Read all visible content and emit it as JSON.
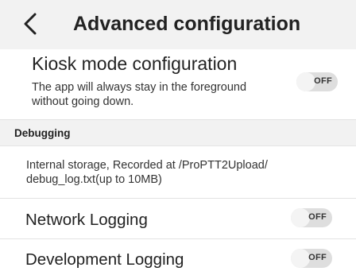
{
  "header": {
    "title": "Advanced configuration"
  },
  "kiosk": {
    "title": "Kiosk mode configuration",
    "description": "The app will always stay in the foreground without going down.",
    "toggle_state": "OFF"
  },
  "debugging": {
    "section_label": "Debugging",
    "info_text": "Internal storage, Recorded at /ProPTT2Upload/ debug_log.txt(up to 10MB)"
  },
  "network_logging": {
    "label": "Network Logging",
    "toggle_state": "OFF"
  },
  "development_logging": {
    "label": "Development Logging",
    "toggle_state": "OFF"
  },
  "icons": {
    "back": "chevron-left-icon"
  }
}
